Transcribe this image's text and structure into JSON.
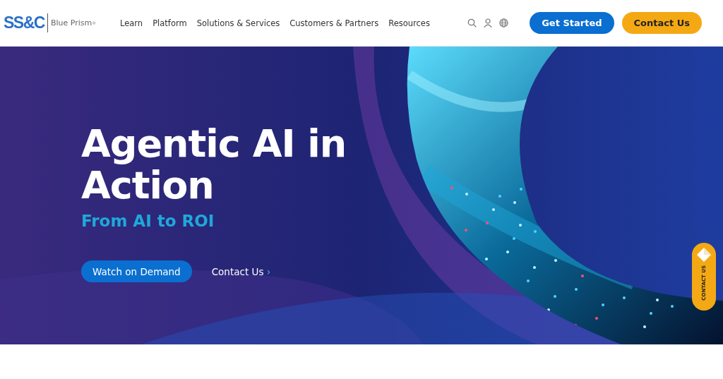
{
  "header": {
    "logo": {
      "mark": "SS&C",
      "name": "Blue Prism",
      "registered": "®"
    },
    "nav": [
      "Learn",
      "Platform",
      "Solutions & Services",
      "Customers & Partners",
      "Resources"
    ],
    "buttons": [
      {
        "label": "Get Started",
        "kind": "primary"
      },
      {
        "label": "Contact Us",
        "kind": "accent"
      }
    ]
  },
  "hero": {
    "kind": "picture",
    "title": "Agentic AI in Action",
    "subtitle": "From AI to ROI",
    "primary_button": "Watch on Demand",
    "link": "Contact Us",
    "link_arrow": "›"
  },
  "side_tab": {
    "label": "CONTACT US"
  }
}
